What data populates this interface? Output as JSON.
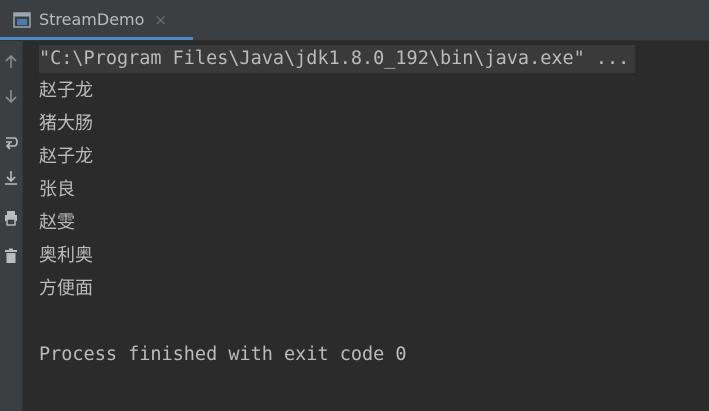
{
  "tab": {
    "title": "StreamDemo",
    "close_glyph": "×"
  },
  "gutter": {
    "icons": [
      "scroll-up-icon",
      "scroll-down-icon",
      "soft-wrap-icon",
      "scroll-to-end-icon",
      "print-icon",
      "trash-icon"
    ]
  },
  "console": {
    "command": "\"C:\\Program Files\\Java\\jdk1.8.0_192\\bin\\java.exe\" ...",
    "output": [
      "赵子龙",
      "猪大肠",
      "赵子龙",
      "张良",
      "赵雯",
      "奥利奥",
      "方便面"
    ],
    "exit_message": "Process finished with exit code 0"
  },
  "colors": {
    "background": "#2b2b2b",
    "panel": "#3c3f41",
    "text": "#bbbbbb",
    "accent": "#4a88c7"
  }
}
